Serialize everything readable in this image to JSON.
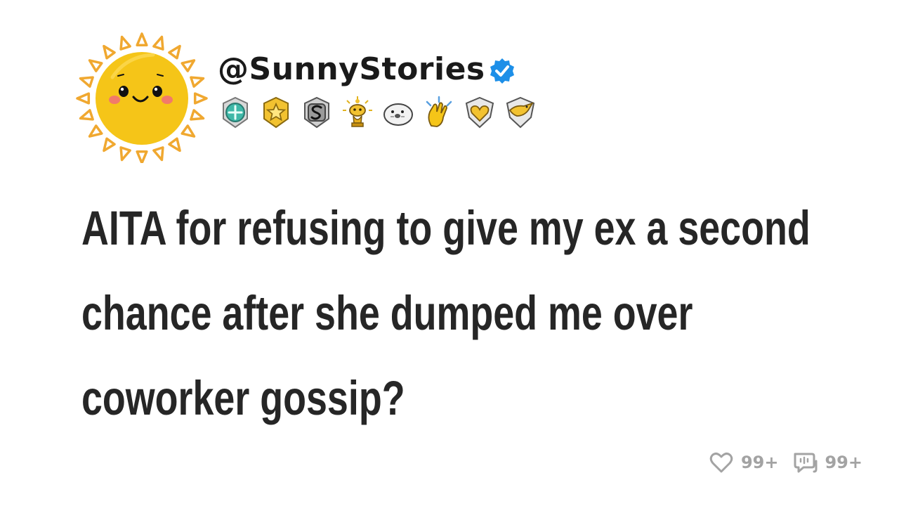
{
  "post": {
    "username": "@SunnyStories",
    "title": "AITA for refusing to give my ex a second chance after she dumped me over coworker gossip?",
    "likes": "99+",
    "comments": "99+"
  },
  "icons": {
    "avatar": "sun-face-avatar",
    "verified": "verified-check-icon",
    "badges": [
      "teal-cross-award-icon",
      "gold-star-award-icon",
      "silver-s-award-icon",
      "gold-snoo-trophy-icon",
      "seal-award-icon",
      "clapping-hands-icon",
      "gold-heart-shield-icon",
      "eagle-shield-icon"
    ],
    "like": "heart-icon",
    "comment": "comment-bubble-icon"
  },
  "colors": {
    "sun": "#f5c518",
    "sun_rays": "#f0a830",
    "verified": "#1d8fe8",
    "title_text": "#262626",
    "stats_text": "#a3a3a3"
  }
}
